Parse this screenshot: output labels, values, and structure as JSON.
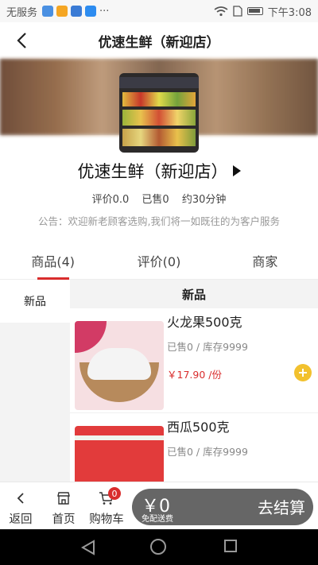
{
  "status_bar": {
    "carrier": "无服务",
    "time": "下午3:08",
    "more": "···",
    "icons": [
      "app-notification-icon",
      "app-notification-icon",
      "video-app-icon",
      "video-app-icon",
      "wifi-icon",
      "sim-icon",
      "battery-icon"
    ]
  },
  "nav": {
    "title": "优速生鲜（新迎店）",
    "back_icon": "back-arrow-icon"
  },
  "store": {
    "name": "优速生鲜（新迎店）",
    "rating": "评价0.0",
    "sold": "已售0",
    "delivery_time": "约30分钟",
    "notice": "公告：欢迎新老顾客选购,我们将一如既往的为客户服务"
  },
  "tabs": [
    {
      "label": "商品(4)",
      "active": true
    },
    {
      "label": "评价(0)",
      "active": false
    },
    {
      "label": "商家",
      "active": false
    }
  ],
  "categories": [
    {
      "label": "新品",
      "selected": true
    }
  ],
  "section_title": "新品",
  "products": [
    {
      "name": "火龙果500克",
      "stock": "已售0 / 库存9999",
      "price": "￥17.90",
      "unit": "/份"
    },
    {
      "name": "西瓜500克",
      "stock": "已售0 / 库存9999"
    }
  ],
  "bottom_bar": {
    "back_label": "返回",
    "home_label": "首页",
    "cart_label": "购物车",
    "cart_count": "0",
    "total": "￥0",
    "shipping_note": "免配送费",
    "checkout_label": "去结算"
  },
  "colors": {
    "accent": "#d92d2d",
    "add_button": "#f2c12e",
    "checkout_bg": "#666666"
  }
}
